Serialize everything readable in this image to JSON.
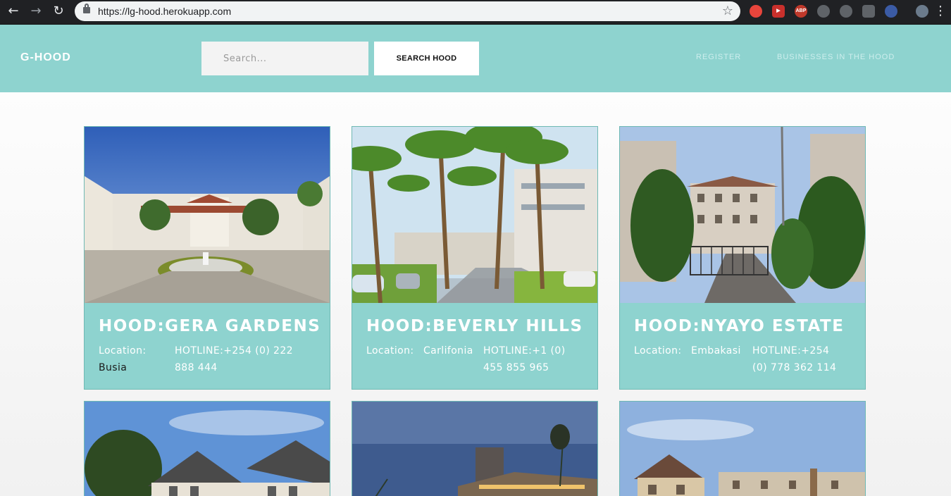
{
  "browser": {
    "url": "https://lg-hood.herokuapp.com",
    "extensions": [
      "ABP"
    ]
  },
  "navbar": {
    "brand": "G-HOOD",
    "search_placeholder": "Search...",
    "search_button": "SEARCH HOOD",
    "links": [
      "REGISTER",
      "BUSINESSES IN THE HOOD"
    ]
  },
  "hoods": [
    {
      "title": "HOOD:GERA GARDENS",
      "location_label": "Location:",
      "location": "Busia",
      "hotline_line1": "HOTLINE:+254 (0) 222",
      "hotline_line2": "888 444"
    },
    {
      "title": "HOOD:BEVERLY HILLS",
      "location_label": "Location:",
      "location": "Carlifonia",
      "hotline_line1": "HOTLINE:+1 (0)",
      "hotline_line2": "455 855 965"
    },
    {
      "title": "HOOD:NYAYO ESTATE",
      "location_label": "Location:",
      "location": "Embakasi",
      "hotline_line1": "HOTLINE:+254",
      "hotline_line2": "(0) 778 362 114"
    }
  ],
  "colors": {
    "accent": "#8ed3cf",
    "chrome": "#202124"
  }
}
